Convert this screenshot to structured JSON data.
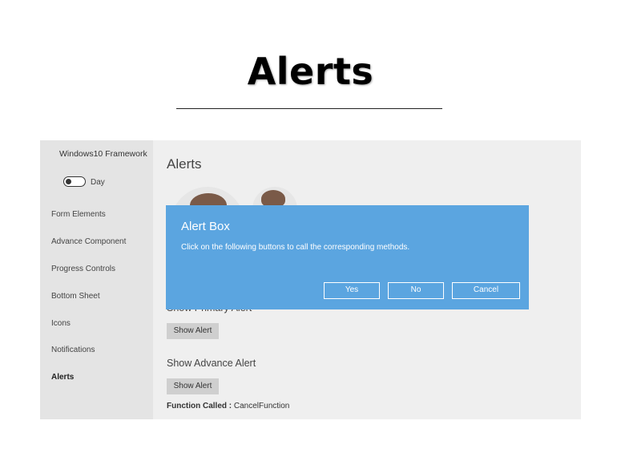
{
  "slide": {
    "title": "Alerts"
  },
  "app": {
    "brand": "Windows10 Framework",
    "theme_toggle_label": "Day",
    "nav": [
      {
        "label": "Form Elements"
      },
      {
        "label": "Advance Component"
      },
      {
        "label": "Progress Controls"
      },
      {
        "label": "Bottom Sheet"
      },
      {
        "label": "Icons"
      },
      {
        "label": "Notifications"
      },
      {
        "label": "Alerts"
      }
    ],
    "active_nav": "Alerts"
  },
  "main": {
    "heading": "Alerts",
    "primary_section_label": "Show Primary Alert",
    "primary_button": "Show Alert",
    "advance_section_label": "Show Advance Alert",
    "advance_button": "Show Alert",
    "function_called_label": "Function Called :",
    "function_called_value": "CancelFunction"
  },
  "dialog": {
    "title": "Alert Box",
    "message": "Click on the following buttons to call the corresponding methods.",
    "buttons": {
      "yes": "Yes",
      "no": "No",
      "cancel": "Cancel"
    },
    "background_color": "#5ba5e0"
  },
  "icons": {
    "toggle": "toggle-switch-icon"
  }
}
